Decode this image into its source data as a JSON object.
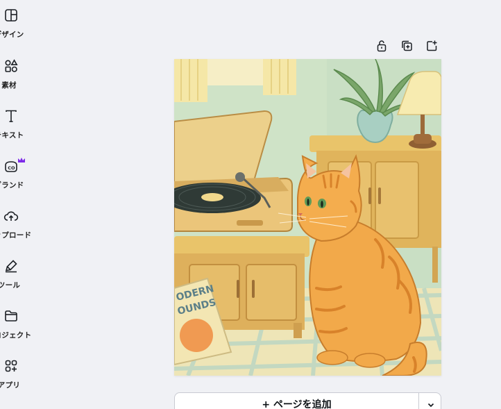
{
  "sidebar": {
    "items": [
      {
        "label": "デザイン",
        "icon": "layout-icon"
      },
      {
        "label": "素材",
        "icon": "elements-icon"
      },
      {
        "label": "テキスト",
        "icon": "text-icon"
      },
      {
        "label": "ブランド",
        "icon": "brand-icon"
      },
      {
        "label": "アップロード",
        "icon": "cloud-upload-icon"
      },
      {
        "label": "ツール",
        "icon": "pen-tool-icon"
      },
      {
        "label": "プロジェクト",
        "icon": "folder-icon"
      },
      {
        "label": "アプリ",
        "icon": "apps-icon"
      }
    ]
  },
  "toolbar": {
    "lock_icon": "lock-icon",
    "duplicate_icon": "duplicate-page-icon",
    "add_icon": "add-page-icon"
  },
  "canvas": {
    "record_sleeve_text_1": "ODERN",
    "record_sleeve_text_2": "OUNDS"
  },
  "footer": {
    "add_page_label": "+ ページを追加",
    "dropdown_icon": "chevron-down-icon"
  },
  "colors": {
    "background": "#f0f1f5",
    "accent_crown": "#7d2ae8"
  }
}
